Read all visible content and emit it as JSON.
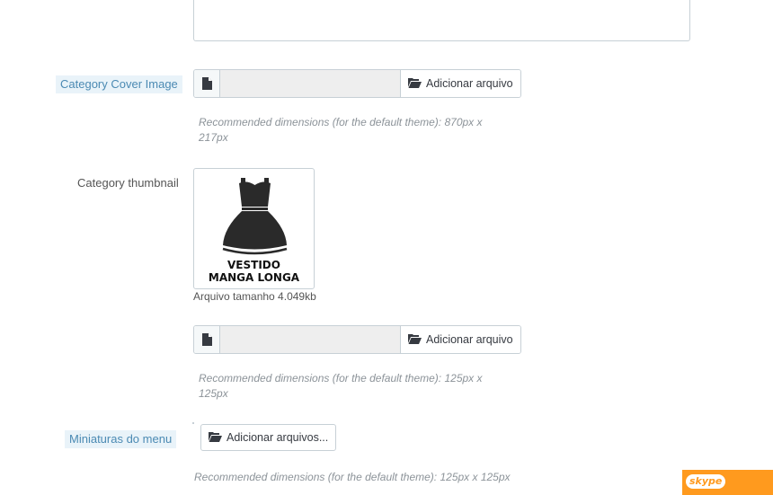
{
  "description_field": {
    "value": ""
  },
  "cover_image": {
    "label": "Category Cover Image",
    "button_label": "Adicionar arquivo",
    "help_line1": "Recommended dimensions (for the default theme): 870px x",
    "help_line2": "217px"
  },
  "thumbnail": {
    "label": "Category thumbnail",
    "image_line1": "VESTIDO",
    "image_line2": "MANGA LONGA",
    "file_size": "Arquivo tamanho 4.049kb",
    "button_label": "Adicionar arquivo",
    "help_line1": "Recommended dimensions (for the default theme): 125px x",
    "help_line2": "125px"
  },
  "menu_thumbnails": {
    "label": "Miniaturas do menu",
    "button_label": "Adicionar arquivos...",
    "help": "Recommended dimensions (for the default theme): 125px x 125px"
  },
  "skype": {
    "label": "skype"
  },
  "colors": {
    "tooltip_bg": "#e9f3f9",
    "tooltip_text": "#4b8ab3",
    "skype_orange": "#ff9a1e"
  },
  "icons": {
    "file": "file-icon",
    "folder_open": "folder-open-icon",
    "dress": "dress-icon"
  }
}
